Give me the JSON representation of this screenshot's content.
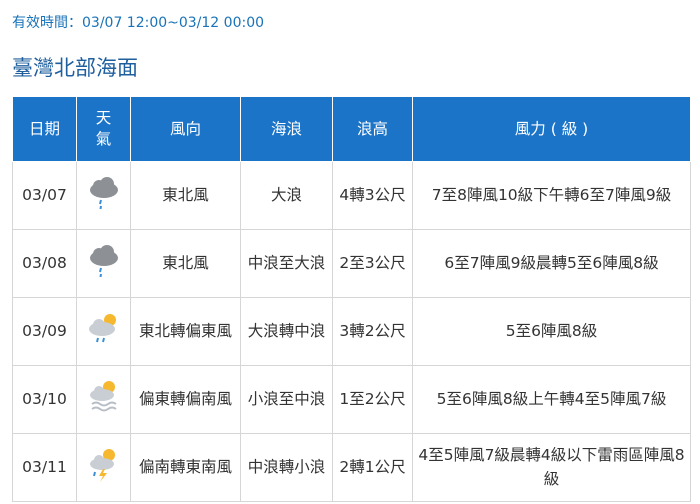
{
  "valid_period": "有效時間：03/07 12:00~03/12 00:00",
  "region": "臺灣北部海面",
  "headers": {
    "date": "日期",
    "weather_line1": "天",
    "weather_line2": "氣",
    "wind_dir": "風向",
    "wave": "海浪",
    "wave_height": "浪高",
    "wind_force": "風力 ( 級 )"
  },
  "rows": [
    {
      "date": "03/07",
      "weather_icon": "cloudy-rain-icon",
      "wind_dir": "東北風",
      "wave": "大浪",
      "wave_height": "4轉3公尺",
      "wind_force": "7至8陣風10級下午轉6至7陣風9級"
    },
    {
      "date": "03/08",
      "weather_icon": "cloudy-rain-icon",
      "wind_dir": "東北風",
      "wave": "中浪至大浪",
      "wave_height": "2至3公尺",
      "wind_force": "6至7陣風9級晨轉5至6陣風8級"
    },
    {
      "date": "03/09",
      "weather_icon": "partly-cloudy-rain-icon",
      "wind_dir": "東北轉偏東風",
      "wave": "大浪轉中浪",
      "wave_height": "3轉2公尺",
      "wind_force": "5至6陣風8級"
    },
    {
      "date": "03/10",
      "weather_icon": "partly-cloudy-fog-icon",
      "wind_dir": "偏東轉偏南風",
      "wave": "小浪至中浪",
      "wave_height": "1至2公尺",
      "wind_force": "5至6陣風8級上午轉4至5陣風7級"
    },
    {
      "date": "03/11",
      "weather_icon": "partly-cloudy-thunderstorm-icon",
      "wind_dir": "偏南轉東南風",
      "wave": "中浪轉小浪",
      "wave_height": "2轉1公尺",
      "wind_force": "4至5陣風7級晨轉4級以下雷雨區陣風8級"
    }
  ]
}
